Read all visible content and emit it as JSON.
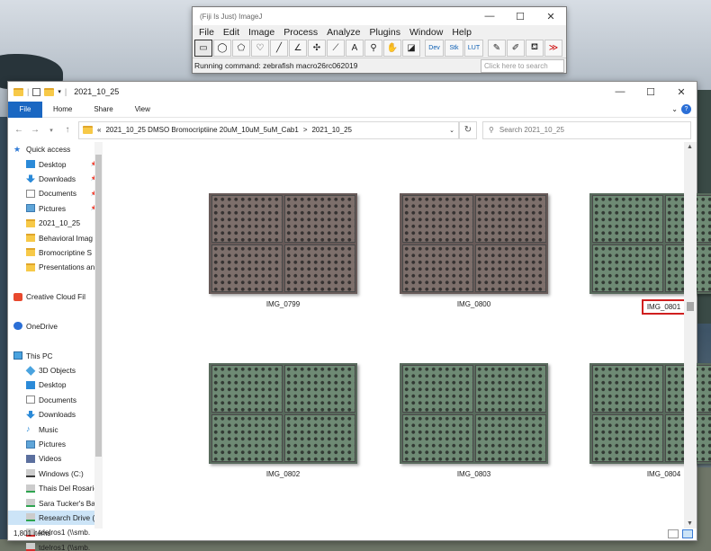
{
  "imagej": {
    "title": "(Fiji Is Just) ImageJ",
    "menu": [
      "File",
      "Edit",
      "Image",
      "Process",
      "Analyze",
      "Plugins",
      "Window",
      "Help"
    ],
    "tools": [
      {
        "icon": "rectangle-tool-icon",
        "glyph": "▭"
      },
      {
        "icon": "oval-tool-icon",
        "glyph": "◯"
      },
      {
        "icon": "polygon-tool-icon",
        "glyph": "⬠"
      },
      {
        "icon": "freehand-tool-icon",
        "glyph": "♡"
      },
      {
        "icon": "line-tool-icon",
        "glyph": "╱"
      },
      {
        "icon": "angle-tool-icon",
        "glyph": "∠"
      },
      {
        "icon": "multipoint-tool-icon",
        "glyph": "✣"
      },
      {
        "icon": "wand-tool-icon",
        "glyph": "⟋"
      },
      {
        "icon": "text-tool-icon",
        "glyph": "A"
      },
      {
        "icon": "magnifier-tool-icon",
        "glyph": "⚲"
      },
      {
        "icon": "hand-tool-icon",
        "glyph": "✋"
      },
      {
        "icon": "color-picker-tool-icon",
        "glyph": "◪"
      },
      {
        "icon": "dev-tool-icon",
        "glyph": "Dev"
      },
      {
        "icon": "stk-tool-icon",
        "glyph": "Stk"
      },
      {
        "icon": "lut-tool-icon",
        "glyph": "LUT"
      },
      {
        "icon": "pencil-tool-icon",
        "glyph": "✎"
      },
      {
        "icon": "brush-tool-icon",
        "glyph": "✐"
      },
      {
        "icon": "flood-fill-tool-icon",
        "glyph": "⛾"
      },
      {
        "icon": "switch-toolset-icon",
        "glyph": "≫"
      }
    ],
    "status": "Running command: zebrafish macro26rc062019",
    "search_placeholder": "Click here to search"
  },
  "explorer": {
    "title": "2021_10_25",
    "ribbon_tabs": [
      "File",
      "Home",
      "Share",
      "View"
    ],
    "address_prefix": "«",
    "address_path": "2021_10_25 DMSO Bromocriptiine 20uM_10uM_5uM_Cab1",
    "address_sep": ">",
    "address_leaf": "2021_10_25",
    "search_placeholder": "Search 2021_10_25",
    "nav": [
      {
        "label": "Quick access",
        "icon": "star",
        "top": true
      },
      {
        "label": "Desktop",
        "icon": "blue",
        "pin": true
      },
      {
        "label": "Downloads",
        "icon": "down",
        "pin": true
      },
      {
        "label": "Documents",
        "icon": "doc",
        "pin": true
      },
      {
        "label": "Pictures",
        "icon": "pic",
        "pin": true
      },
      {
        "label": "2021_10_25",
        "icon": "fold"
      },
      {
        "label": "Behavioral Imag",
        "icon": "fold"
      },
      {
        "label": "Bromocriptine S",
        "icon": "fold"
      },
      {
        "label": "Presentations an",
        "icon": "fold"
      },
      {
        "label": "",
        "icon": "none"
      },
      {
        "label": "Creative Cloud Fil",
        "icon": "cc",
        "top": true
      },
      {
        "label": "",
        "icon": "none"
      },
      {
        "label": "OneDrive",
        "icon": "cloud",
        "top": true
      },
      {
        "label": "",
        "icon": "none"
      },
      {
        "label": "This PC",
        "icon": "pc",
        "top": true
      },
      {
        "label": "3D Objects",
        "icon": "cube"
      },
      {
        "label": "Desktop",
        "icon": "blue"
      },
      {
        "label": "Documents",
        "icon": "doc"
      },
      {
        "label": "Downloads",
        "icon": "down"
      },
      {
        "label": "Music",
        "icon": "music"
      },
      {
        "label": "Pictures",
        "icon": "pic"
      },
      {
        "label": "Videos",
        "icon": "vid"
      },
      {
        "label": "Windows (C:)",
        "icon": "drive"
      },
      {
        "label": "Thais Del Rosario",
        "icon": "net"
      },
      {
        "label": "Sara Tucker's Ba",
        "icon": "net"
      },
      {
        "label": "Research Drive (I",
        "icon": "net",
        "selected": true
      },
      {
        "label": "tdelros1 (\\\\smb.",
        "icon": "netx"
      },
      {
        "label": "tdelros1 (\\\\smb.",
        "icon": "netx"
      }
    ],
    "images": [
      {
        "name": "IMG_0799",
        "tint": "a"
      },
      {
        "name": "IMG_0800",
        "tint": "a"
      },
      {
        "name": "IMG_0801",
        "tint": "b",
        "highlighted": true
      },
      {
        "name": "IMG_0802",
        "tint": "b"
      },
      {
        "name": "IMG_0803",
        "tint": "b"
      },
      {
        "name": "IMG_0804",
        "tint": "b"
      }
    ],
    "item_count": "1,801 items"
  }
}
